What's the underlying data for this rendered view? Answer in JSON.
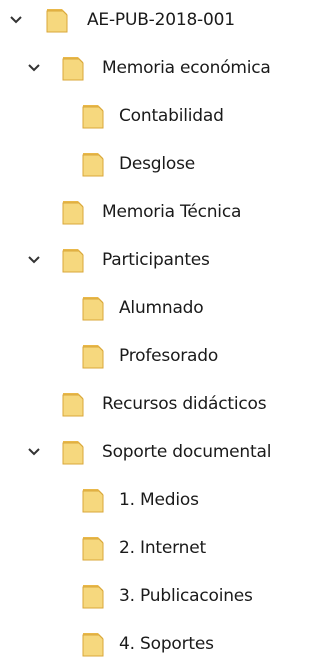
{
  "tree": {
    "root": {
      "label": "AE-PUB-2018-001",
      "expanded": true,
      "icon": "folder-icon",
      "children": [
        {
          "label": "Memoria económica",
          "expanded": true,
          "icon": "folder-icon",
          "children": [
            {
              "label": "Contabilidad",
              "icon": "folder-icon"
            },
            {
              "label": "Desglose",
              "icon": "folder-icon"
            }
          ]
        },
        {
          "label": "Memoria Técnica",
          "icon": "folder-icon"
        },
        {
          "label": "Participantes",
          "expanded": true,
          "icon": "folder-icon",
          "children": [
            {
              "label": "Alumnado",
              "icon": "folder-icon"
            },
            {
              "label": "Profesorado",
              "icon": "folder-icon"
            }
          ]
        },
        {
          "label": "Recursos didácticos",
          "icon": "folder-icon"
        },
        {
          "label": "Soporte documental",
          "expanded": true,
          "icon": "folder-icon",
          "children": [
            {
              "label": "1. Medios",
              "icon": "folder-icon"
            },
            {
              "label": "2. Internet",
              "icon": "folder-icon"
            },
            {
              "label": "3. Publicacoines",
              "icon": "folder-icon"
            },
            {
              "label": "4. Soportes",
              "icon": "folder-icon"
            }
          ]
        }
      ]
    }
  },
  "colors": {
    "folder_fill": "#f6d87e",
    "folder_back": "#e9b84a",
    "folder_edge": "#d9a73a",
    "chevron": "#333333",
    "text": "#1a1a1a"
  }
}
